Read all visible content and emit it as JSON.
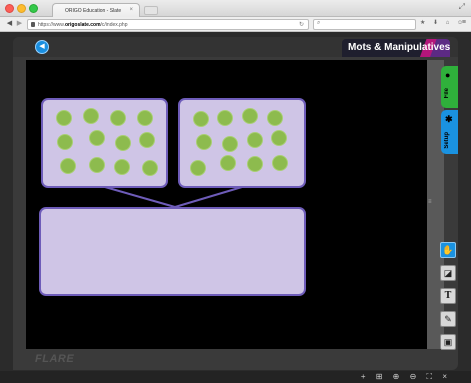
{
  "browser": {
    "tab_title": "ORIGO Education - Slate",
    "tab_close": "×",
    "url_prefix": "https://www.",
    "url_domain": "origoslate.com",
    "url_path": "/c/index.php",
    "reload": "↻",
    "search_glyph": "⌕",
    "toolbar_icons": "★ ⬇ ⌂ ☺",
    "menu": "≡",
    "expand": "⤢"
  },
  "app": {
    "title": "Mots & Manipulatives",
    "sound_glyph": "◀"
  },
  "side_tabs": {
    "file_label": "File",
    "setup_label": "Setup"
  },
  "tools": {
    "hand": "✋",
    "eraser": "◪",
    "text": "T",
    "pen": "✎",
    "save": "▣"
  },
  "footer": {
    "logo": "FLARE",
    "controls": "+ ⊞ ⊕ ⊖   ⛶ ×"
  },
  "counters": {
    "left_box_count": 12,
    "right_box_count": 12
  },
  "colors": {
    "counter_green": "#8dbb4e",
    "box_fill": "#cfc5e6",
    "box_border": "#6e5cb9",
    "file_tab": "#2fb03b",
    "setup_tab": "#1a92e0"
  }
}
